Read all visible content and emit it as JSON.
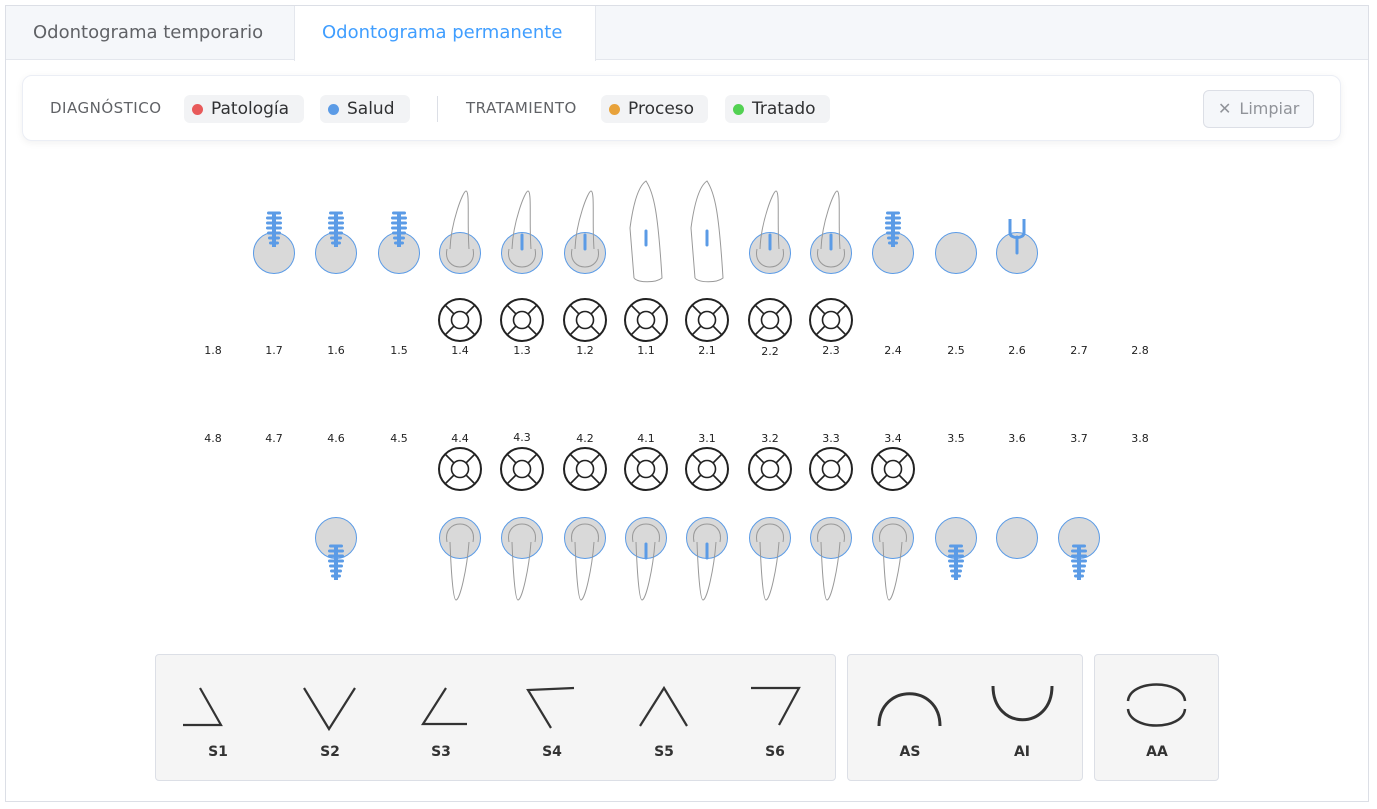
{
  "tabs": [
    {
      "label": "Odontograma temporario",
      "active": false
    },
    {
      "label": "Odontograma permanente",
      "active": true
    }
  ],
  "legend": {
    "diagnostico_title": "DIAGNÓSTICO",
    "tratamiento_title": "TRATAMIENTO",
    "items": [
      {
        "label": "Patología",
        "color": "#e85a5a"
      },
      {
        "label": "Salud",
        "color": "#5b9be6"
      },
      {
        "label": "Proceso",
        "color": "#e8a23a"
      },
      {
        "label": "Tratado",
        "color": "#52d152"
      }
    ],
    "clear_label": "Limpiar"
  },
  "upper_numbers": [
    "1.8",
    "1.7",
    "1.6",
    "1.5",
    "1.4",
    "1.3",
    "1.2",
    "1.1",
    "2.1",
    "2.2",
    "2.3",
    "2.4",
    "2.5",
    "2.6",
    "2.7",
    "2.8"
  ],
  "lower_numbers": [
    "4.8",
    "4.7",
    "4.6",
    "4.5",
    "4.4",
    "4.3",
    "4.2",
    "4.1",
    "3.1",
    "3.2",
    "3.3",
    "3.4",
    "3.5",
    "3.6",
    "3.7",
    "3.8"
  ],
  "colors": {
    "salud": "#5b9be6",
    "tooth_fill": "#d9d9d9",
    "outline": "#222222"
  },
  "symbols_group1": [
    {
      "label": "S1"
    },
    {
      "label": "S2"
    },
    {
      "label": "S3"
    },
    {
      "label": "S4"
    },
    {
      "label": "S5"
    },
    {
      "label": "S6"
    }
  ],
  "symbols_group2": [
    {
      "label": "AS"
    },
    {
      "label": "AI"
    }
  ],
  "symbols_group3": [
    {
      "label": "AA"
    }
  ]
}
